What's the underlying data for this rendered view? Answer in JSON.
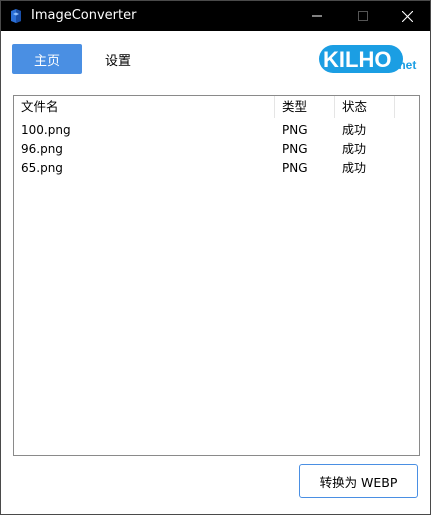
{
  "window": {
    "title": "ImageConverter",
    "icon": "app-icon",
    "controls": [
      "minimize-icon",
      "maximize-icon",
      "close-icon"
    ]
  },
  "nav": {
    "home_label": "主页",
    "settings_label": "设置",
    "active": "home"
  },
  "logo": {
    "text": "KILHO",
    "suffix": ".net"
  },
  "file_list": {
    "columns": [
      "文件名",
      "类型",
      "状态"
    ],
    "rows": [
      {
        "name": "100.png",
        "type": "PNG",
        "status": "成功"
      },
      {
        "name": "96.png",
        "type": "PNG",
        "status": "成功"
      },
      {
        "name": "65.png",
        "type": "PNG",
        "status": "成功"
      }
    ]
  },
  "actions": {
    "convert_label": "转换为 WEBP"
  },
  "colors": {
    "accent": "#4a8fe3",
    "titlebar": "#000000",
    "logo_blue": "#1b9ee3"
  }
}
